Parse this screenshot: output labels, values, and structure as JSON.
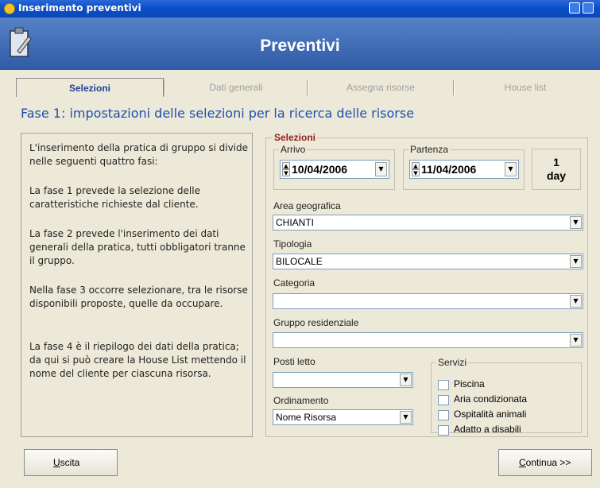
{
  "window": {
    "title": "Inserimento preventivi"
  },
  "header": {
    "title": "Preventivi"
  },
  "tabs": [
    {
      "label": "Selezioni"
    },
    {
      "label": "Dati generali"
    },
    {
      "label": "Assegna risorse"
    },
    {
      "label": "House list"
    }
  ],
  "phase_title": "Fase 1: impostazioni delle selezioni per la ricerca delle risorse",
  "instructions": [
    "L'inserimento della pratica di gruppo si divide nelle seguenti quattro fasi:",
    "La fase 1 prevede la selezione delle caratteristiche richieste dal cliente.",
    "La fase 2 prevede l'inserimento dei dati generali della pratica, tutti obbligatori tranne il gruppo.",
    "Nella fase 3 occorre selezionare, tra le risorse disponibili proposte, quelle da occupare.",
    "La fase 4 è il riepilogo dei dati della pratica; da qui si può creare la House List mettendo il nome del cliente per ciascuna risorsa."
  ],
  "selections": {
    "legend": "Selezioni",
    "arrivo": {
      "label": "Arrivo",
      "value": "10/04/2006"
    },
    "partenza": {
      "label": "Partenza",
      "value": "11/04/2006"
    },
    "days": {
      "number": "1",
      "unit": "day"
    },
    "area": {
      "label": "Area geografica",
      "value": "CHIANTI"
    },
    "tipologia": {
      "label": "Tipologia",
      "value": "BILOCALE"
    },
    "categoria": {
      "label": "Categoria",
      "value": ""
    },
    "gruppo": {
      "label": "Gruppo residenziale",
      "value": ""
    },
    "posti": {
      "label": "Posti letto",
      "value": ""
    },
    "ordinamento": {
      "label": "Ordinamento",
      "value": "Nome Risorsa"
    },
    "servizi": {
      "legend": "Servizi",
      "items": [
        "Piscina",
        "Aria condizionata",
        "Ospitalità animali",
        "Adatto a disabili"
      ]
    }
  },
  "buttons": {
    "exit": {
      "first": "U",
      "rest": "scita"
    },
    "next": {
      "first": "C",
      "rest": "ontinua >>"
    }
  }
}
